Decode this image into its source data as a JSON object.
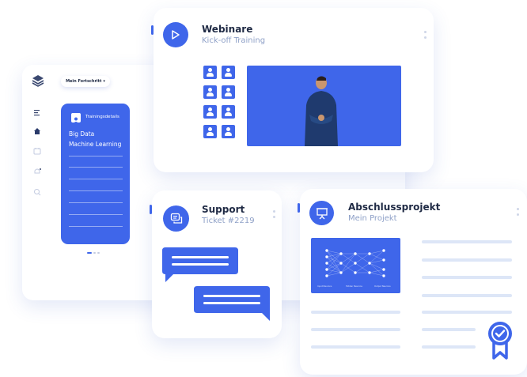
{
  "dashboard": {
    "progress_dropdown": "Mein Fortschritt",
    "sidebar_icons": [
      "menu-icon",
      "home-icon",
      "calendar-icon",
      "bell-icon",
      "search-icon"
    ],
    "panel": {
      "header": "Trainingsdetails",
      "line1": "Big Data",
      "line2": "Machine Learning"
    }
  },
  "webinar": {
    "title": "Webinare",
    "subtitle": "Kick-off Training"
  },
  "support": {
    "title": "Support",
    "subtitle": "Ticket #2219"
  },
  "project": {
    "title": "Abschlussprojekt",
    "subtitle": "Mein Projekt",
    "diagram_labels": [
      "Input Neurons",
      "Hidden Neurons",
      "Output Neurons"
    ]
  },
  "colors": {
    "accent": "#3f66ea",
    "line": "#dde6f7"
  }
}
